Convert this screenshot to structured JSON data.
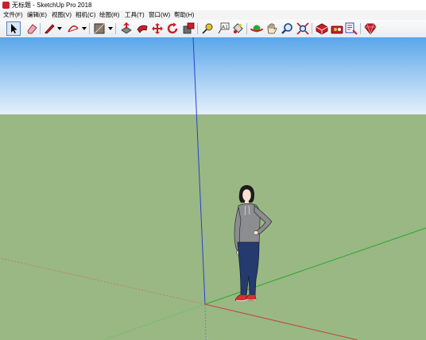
{
  "window": {
    "title": "无标题 - SketchUp Pro 2018"
  },
  "menu": {
    "items": [
      "文件(F)",
      "编辑(E)",
      "视图(V)",
      "相机(C)",
      "绘图(R)",
      "工具(T)",
      "窗口(W)",
      "帮助(H)"
    ]
  },
  "toolbar": {
    "tools": [
      {
        "name": "select-tool-icon"
      },
      {
        "name": "eraser-tool-icon"
      },
      {
        "name": "pencil-line-tool-icon"
      },
      {
        "name": "arc-tool-icon"
      },
      {
        "name": "rectangle-shape-tool-icon"
      },
      {
        "name": "push-pull-tool-icon"
      },
      {
        "name": "follow-me-tool-icon"
      },
      {
        "name": "move-tool-icon"
      },
      {
        "name": "rotate-tool-icon"
      },
      {
        "name": "offset-tool-icon"
      },
      {
        "name": "tape-measure-tool-icon"
      },
      {
        "name": "text-tool-icon"
      },
      {
        "name": "paint-bucket-tool-icon"
      },
      {
        "name": "orbit-tool-icon"
      },
      {
        "name": "pan-tool-icon"
      },
      {
        "name": "zoom-tool-icon"
      },
      {
        "name": "zoom-extents-tool-icon"
      },
      {
        "name": "3d-warehouse-icon"
      },
      {
        "name": "extension-warehouse-icon"
      },
      {
        "name": "layout-send-icon"
      },
      {
        "name": "ruby-extension-icon"
      }
    ]
  },
  "colors": {
    "sky_top": "#5aa6ea",
    "sky_bottom": "#e6f1fb",
    "ground": "#99b884",
    "axis_blue": "#2b3fd0",
    "axis_green": "#2ea72e",
    "axis_red": "#c2463a",
    "toolbar_accent": "#c8202a"
  }
}
